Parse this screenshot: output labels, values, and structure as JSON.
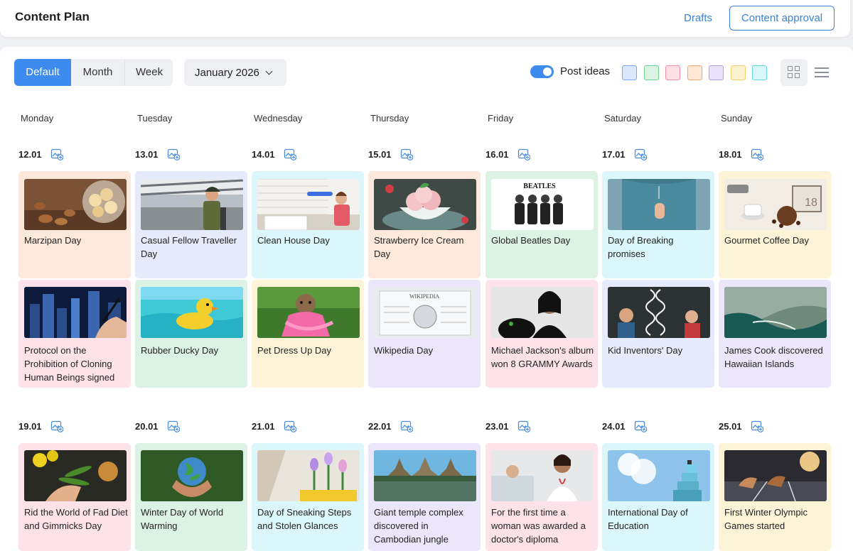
{
  "header": {
    "title": "Content Plan",
    "drafts_label": "Drafts",
    "approval_label": "Content approval"
  },
  "toolbar": {
    "views": [
      "Default",
      "Month",
      "Week"
    ],
    "active_view": "Default",
    "date_label": "January 2026",
    "post_ideas_label": "Post ideas",
    "post_ideas_on": true,
    "filter_colors": [
      {
        "fill": "#dbe7fb",
        "border": "#7aa7ea"
      },
      {
        "fill": "#dcf3e3",
        "border": "#6fcf8f"
      },
      {
        "fill": "#fde0e7",
        "border": "#ef8ea4"
      },
      {
        "fill": "#fde8d6",
        "border": "#f3a66b"
      },
      {
        "fill": "#ebe3fb",
        "border": "#b39af0"
      },
      {
        "fill": "#fdf2cf",
        "border": "#f3cf6a"
      },
      {
        "fill": "#d9f6fa",
        "border": "#66d6e5"
      }
    ]
  },
  "calendar": {
    "day_names": [
      "Monday",
      "Tuesday",
      "Wednesday",
      "Thursday",
      "Friday",
      "Saturday",
      "Sunday"
    ],
    "weeks": [
      {
        "dates": [
          "12.01",
          "13.01",
          "14.01",
          "15.01",
          "16.01",
          "17.01",
          "18.01"
        ],
        "rows": [
          [
            {
              "title": "Marzipan Day",
              "color": "#fde8dc",
              "image": "marzipan-photo"
            },
            {
              "title": "Casual Fellow Traveller Day",
              "color": "#e6ebfb",
              "image": "traveller-photo"
            },
            {
              "title": "Clean House Day",
              "color": "#dcf7fb",
              "image": "cleaning-photo"
            },
            {
              "title": "Strawberry Ice Cream Day",
              "color": "#fde8dc",
              "image": "ice-cream-photo"
            },
            {
              "title": "Global Beatles Day",
              "color": "#dcf2e4",
              "image": "beatles-photo"
            },
            {
              "title": "Day of Breaking promises",
              "color": "#dcf7fb",
              "image": "crossed-fingers-photo"
            },
            {
              "title": "Gourmet Coffee Day",
              "color": "#fdf4d8",
              "image": "coffee-photo"
            }
          ],
          [
            {
              "title": "Protocol on the Prohibition of Cloning Human Beings signed",
              "color": "#fde3e9",
              "image": "city-signing-photo"
            },
            {
              "title": "Rubber Ducky Day",
              "color": "#dcf2e4",
              "image": "rubber-duck-photo"
            },
            {
              "title": "Pet Dress Up Day",
              "color": "#fdf4d8",
              "image": "dressed-dog-photo"
            },
            {
              "title": "Wikipedia Day",
              "color": "#ece6fb",
              "image": "wikipedia-photo"
            },
            {
              "title": "Michael Jackson's album won 8 GRAMMY Awards",
              "color": "#fde3e9",
              "image": "michael-jackson-photo"
            },
            {
              "title": "Kid Inventors' Day",
              "color": "#e6ebfb",
              "image": "kids-dna-photo"
            },
            {
              "title": "James Cook discovered Hawaiian Islands",
              "color": "#ece6fb",
              "image": "hawaii-coast-photo"
            }
          ]
        ]
      },
      {
        "dates": [
          "19.01",
          "20.01",
          "21.01",
          "22.01",
          "23.01",
          "24.01",
          "25.01"
        ],
        "rows": [
          [
            {
              "title": "Rid the World of Fad Diet and Gimmicks Day",
              "color": "#fde3e9",
              "image": "healthy-food-photo"
            },
            {
              "title": "Winter Day of World Warming",
              "color": "#dcf2e4",
              "image": "globe-hands-photo"
            },
            {
              "title": "Day of Sneaking Steps and Stolen Glances",
              "color": "#dcf7fb",
              "image": "flowers-window-photo"
            },
            {
              "title": "Giant temple complex discovered in Cambodian jungle",
              "color": "#ece6fb",
              "image": "angkor-temple-photo"
            },
            {
              "title": "For the first time a woman was awarded a doctor's diploma",
              "color": "#fde3e9",
              "image": "doctor-photo"
            },
            {
              "title": "International Day of Education",
              "color": "#dcf7fb",
              "image": "education-stairs-photo"
            },
            {
              "title": "First Winter Olympic Games started",
              "color": "#fdf4d8",
              "image": "sprinters-photo"
            }
          ]
        ]
      }
    ]
  }
}
